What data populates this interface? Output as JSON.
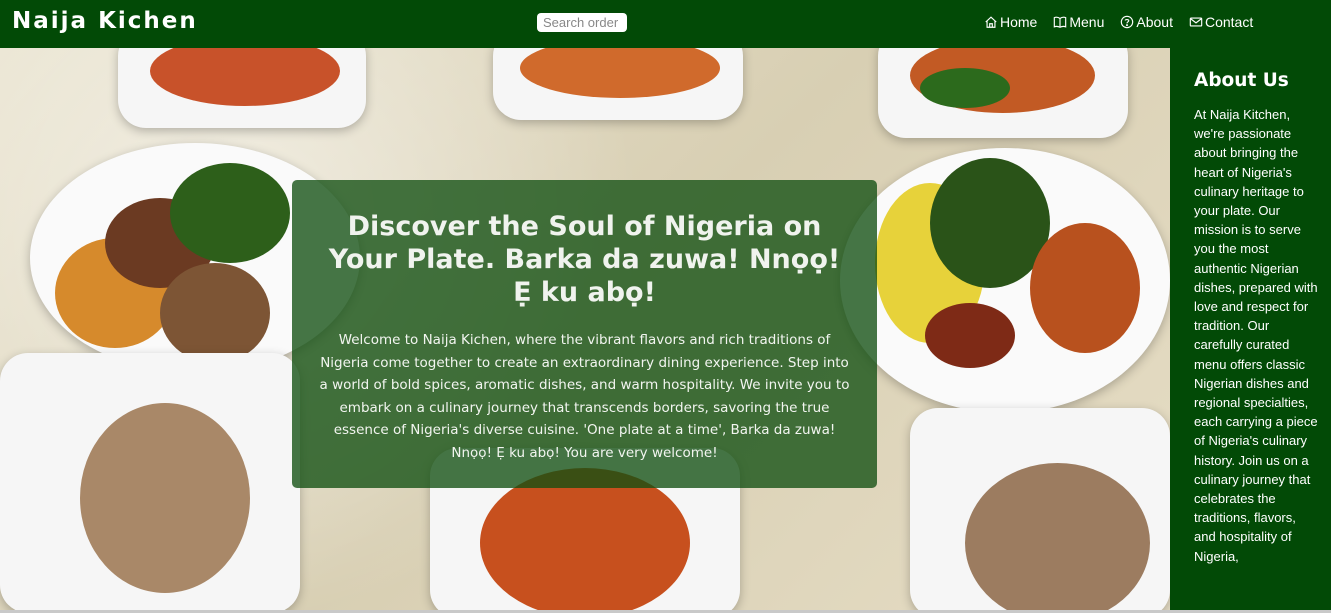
{
  "header": {
    "brand": "Naija Kichen",
    "search_placeholder": "Search order item",
    "nav": [
      {
        "label": "Home",
        "icon": "home-icon"
      },
      {
        "label": "Menu",
        "icon": "book-icon"
      },
      {
        "label": "About",
        "icon": "question-circle-icon"
      },
      {
        "label": "Contact",
        "icon": "envelope-icon"
      }
    ]
  },
  "hero": {
    "title": "Discover the Soul of Nigeria on Your Plate. Barka da zuwa! Nnọọ! Ẹ ku abọ!",
    "text": "Welcome to Naija Kichen, where the vibrant flavors and rich traditions of Nigeria come together to create an extraordinary dining experience. Step into a world of bold spices, aromatic dishes, and warm hospitality. We invite you to embark on a culinary journey that transcends borders, savoring the true essence of Nigeria's diverse cuisine. 'One plate at a time', Barka da zuwa! Nnọọ! Ẹ ku abọ! You are very welcome!"
  },
  "sidebar": {
    "title": "About Us",
    "text": "At Naija Kitchen, we're passionate about bringing the heart of Nigeria's culinary heritage to your plate. Our mission is to serve you the most authentic Nigerian dishes, prepared with love and respect for tradition. Our carefully curated menu offers classic Nigerian dishes and regional specialties, each carrying a piece of Nigeria's culinary history. Join us on a culinary journey that celebrates the traditions, flavors, and hospitality of Nigeria,"
  },
  "colors": {
    "nav_bg": "#024a06",
    "card_bg": "rgba(18, 80, 18, 0.78)"
  }
}
